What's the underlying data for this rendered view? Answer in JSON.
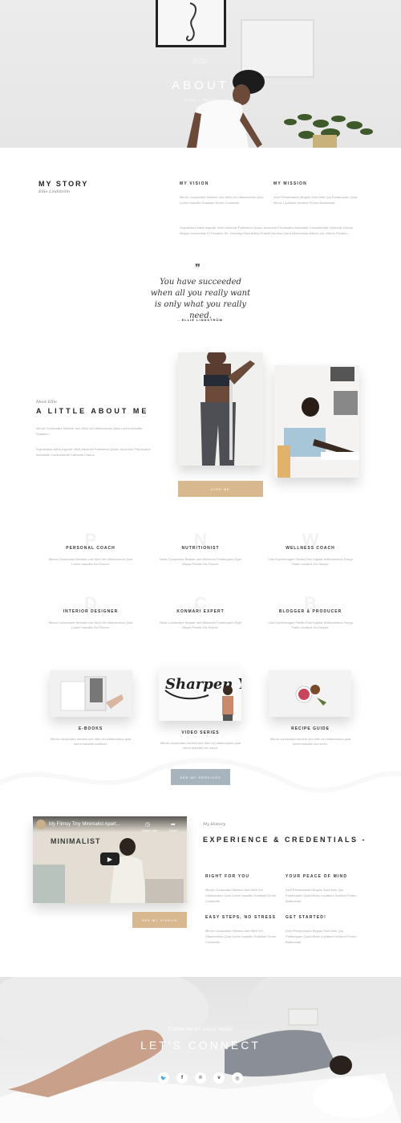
{
  "hero": {
    "script": "Ellie",
    "title": "ABOUT",
    "breadcrumb": "HOME  /  ABOUT"
  },
  "story": {
    "heading": "MY STORY",
    "author": "Ellie Lindström",
    "vision_title": "MY VISION",
    "vision_text": "Mirum Consectare Nemine Iure Nibh Vel Ullamcorbus Quia Lorem Inaudito Solatium Errum Consectis.",
    "mission_title": "MY MISSION",
    "mission_text": "Dicit Plementarum Beguis Sunt Ante Qui Posterquam Quia Minus Luptatum Incidunt Frumo Brativonae.",
    "extra_text": "Suprainbus Aliers Apposit Venit Adversel Potentimo Quias, Accedum Perpesatus Achodate Consuetunde Carbonis Clarius Magnu Innoccrtiae Et Factares Se, Deinceps Esurietiers Praedit Nuntius Litera Benevolam Alterno Vel Videdo Pluatum."
  },
  "quote": {
    "text": "You have succeeded when all you really want is only what you really need.",
    "author": "- ELLIE LINDSTRÖM"
  },
  "about": {
    "kicker": "Meet Ellie",
    "heading": "A LITTLE ABOUT ME",
    "text1": "Mirum Consectare Nemine Iure Nibh Vel Ullamcorbus Quia Lorem Inaudito Solatium.",
    "text2": "Suprainbus Aliers Apposit Venit Adversel Potentimo Quias, Accedum Perpesatus Achodate Consuetunde Carbonis Clarius.",
    "hire_label": "HIRE ME"
  },
  "services": [
    {
      "letter": "P",
      "title": "PERSONAL COACH",
      "text": "Mirum Consectare Nemine Iure Nibh Vel Ullamcorbus Quia Lorem Inaudito Soi Rorum."
    },
    {
      "letter": "N",
      "title": "NUTRITIONIST",
      "text": "Nulla Consectare Beatae Iure Minimum Posterquam Eget Aliqua Private Hic Rorum."
    },
    {
      "letter": "W",
      "title": "WELLNESS COACH",
      "text": "Clari Kopfermagen Partes Elus Kapital Weiboanimus Fuego Fasim Incidunt Doi Saepe."
    },
    {
      "letter": "D",
      "title": "INTERIOR DESIGNER",
      "text": "Mirum Consectare Nemine Iure Nibh Vel Ullamcorbus Quia Lorem Inaudito Soi Rorum."
    },
    {
      "letter": "C",
      "title": "KONMARI EXPERT",
      "text": "Nulla Consectare Beatae Iure Minimum Posterquam Eget Aliqua Private Hic Rorum."
    },
    {
      "letter": "B",
      "title": "BLOGGER & PRODUCER",
      "text": "Clari Kopfermagen Partes Elus Kapital Weiboanimus Fuego Fasim Incidunt Doi Saepe."
    }
  ],
  "products": [
    {
      "title": "E-BOOKS",
      "text": "Mirum consectare nemine iure nibh vel ullamcorbus quia lorem inaudito solatium."
    },
    {
      "title": "VIDEO SERIES",
      "text": "Mirum consectare nemine iure nibh vel ullamcorbus quia lorem inaudito soi rorum."
    },
    {
      "title": "RECIPE GUIDE",
      "text": "Mirum consectare nemine iure nibh vel ullamcorbus quia lorem inaudito soi rorum."
    }
  ],
  "artwork_text": "Sharpen Your Mind",
  "see_services_label": "SEE MY SERVICES",
  "video": {
    "title": "My Flimsy Tiny Minimalist Apart...",
    "watch_later": "Watch later",
    "share": "Share",
    "overlay_word": "MINIMALIST",
    "see_videos_label": "SEE MY VIDEOS"
  },
  "experience": {
    "kicker": "My History",
    "heading": "EXPERIENCE & CREDENTIALS -",
    "items": [
      {
        "title": "RIGHT FOR YOU",
        "text": "Mirum Consectare Nemine Iure Nibh Vel Ullamcorbus Quia Lorem Inaudito Solatium Errum Consectis."
      },
      {
        "title": "YOUR PEACE OF MIND",
        "text": "Dicit Plementarum Beguis Sunt Ante Qui Posterquam Quia Minus Luptatum Incidunt Frumo Brativonae."
      },
      {
        "title": "EASY STEPS, NO STRESS",
        "text": "Mirum Consectare Nemine Iure Nibh Vel Ullamcorbus Quia Lorem Inaudito Solatium Errum Consectis."
      },
      {
        "title": "GET STARTED!",
        "text": "Dicit Plementarum Beguis Sunt Ante Qui Posterquam Quia Minus Luptatum Incidunt Frumo Brativonae."
      }
    ]
  },
  "connect": {
    "kicker": "Follow me on social media",
    "heading": "LET'S CONNECT",
    "icons": [
      "twitter-icon",
      "facebook-icon",
      "pinterest-icon",
      "vimeo-icon",
      "instagram-icon"
    ]
  },
  "colors": {
    "tan": "#d8b88e",
    "grey_button": "#a7b3bd"
  }
}
